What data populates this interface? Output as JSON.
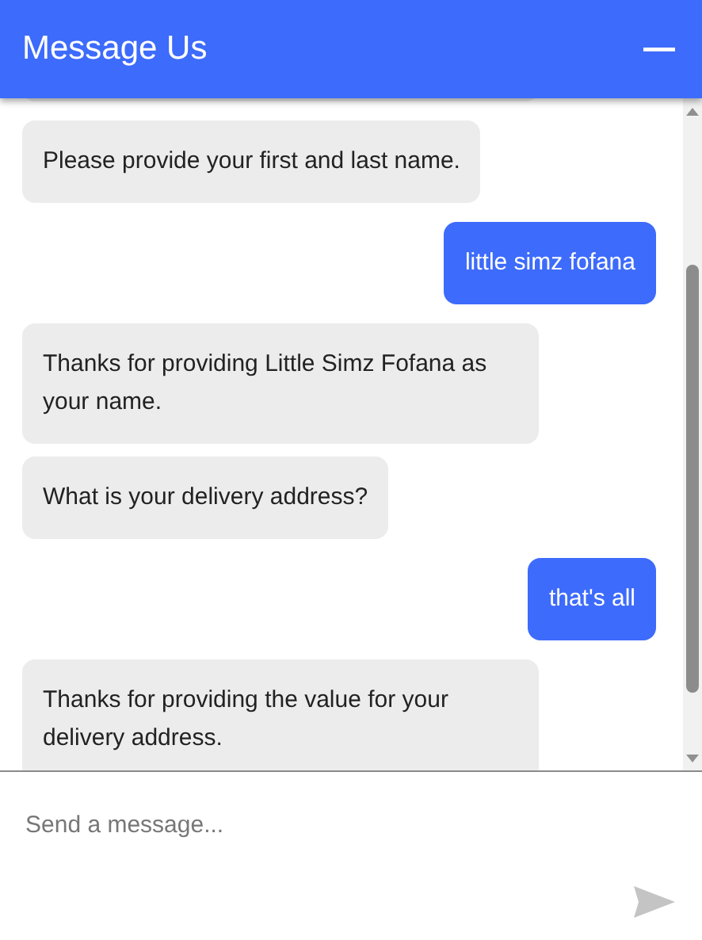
{
  "header": {
    "title": "Message Us"
  },
  "messages": [
    {
      "kind": "bot",
      "text": "Please provide your first and last name."
    },
    {
      "kind": "user",
      "text": "little simz fofana"
    },
    {
      "kind": "bot",
      "text": "Thanks for providing Little Simz Fofana as your name."
    },
    {
      "kind": "bot",
      "text": "What is your delivery address?"
    },
    {
      "kind": "user",
      "text": "that's all"
    },
    {
      "kind": "bot",
      "text": "Thanks for providing the value for your delivery address."
    }
  ],
  "composer": {
    "placeholder": "Send a message..."
  }
}
